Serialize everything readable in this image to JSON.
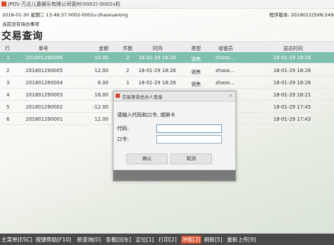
{
  "window": {
    "title": "JPOS-万达儿童娱乐有限公司德州(0002)-0002v机"
  },
  "infobar": {
    "left": "2018-01-30 星期二 13:48:37 0002-0002v-zhaoxuerong",
    "right": "程序版本: 2018011(SVN:24960)"
  },
  "todo": "当前没有待办事项",
  "page_title": "交易查询",
  "table": {
    "headers": [
      "行",
      "单号",
      "金额",
      "件数",
      "时间",
      "类型",
      "收银员",
      "送达时间"
    ],
    "rows": [
      [
        "1",
        "201801290006",
        "10.00",
        "2",
        "18-01-29 18:26",
        "销售",
        "zhaox...",
        "18-01-29 18:26"
      ],
      [
        "2",
        "201801290005",
        "12.00",
        "2",
        "18-01-29 18:26",
        "销售",
        "zhaox...",
        "18-01-29 18:26"
      ],
      [
        "3",
        "201801290004",
        "6.00",
        "1",
        "18-01-29 18:26",
        "销售",
        "zhaox...",
        "18-01-29 18:26"
      ],
      [
        "4",
        "201801290003",
        "16.00",
        "",
        "",
        "",
        "",
        "18-01-29 18:21"
      ],
      [
        "5",
        "201801290002",
        "-12.00",
        "",
        "",
        "",
        "",
        "18-01-29 17:45"
      ],
      [
        "6",
        "201801290001",
        "12.00",
        "",
        "",
        "",
        "",
        "18-01-29 17:43"
      ]
    ],
    "selected_row": 0
  },
  "dialog": {
    "title": "交易查询总办人登录",
    "close": "×",
    "prompt": "请输入代码和口令, 或刷卡",
    "code_label": "代码:",
    "code_value": "",
    "password_label": "口令:",
    "password_value": "",
    "ok_label": "确认",
    "cancel_label": "取消"
  },
  "bottom_keys": [
    "主菜单[ESC]",
    "按键帮助[F10]",
    "新查询[0]",
    "查看[回车]",
    "定位[1]",
    "打印[2]",
    "冲账[3]",
    "刷新[5]",
    "重新上传[9]"
  ],
  "colors": {
    "selected_row": "#7fbfae",
    "highlight_key": "#e05a3a",
    "bottombar": "#4a4a4a"
  }
}
